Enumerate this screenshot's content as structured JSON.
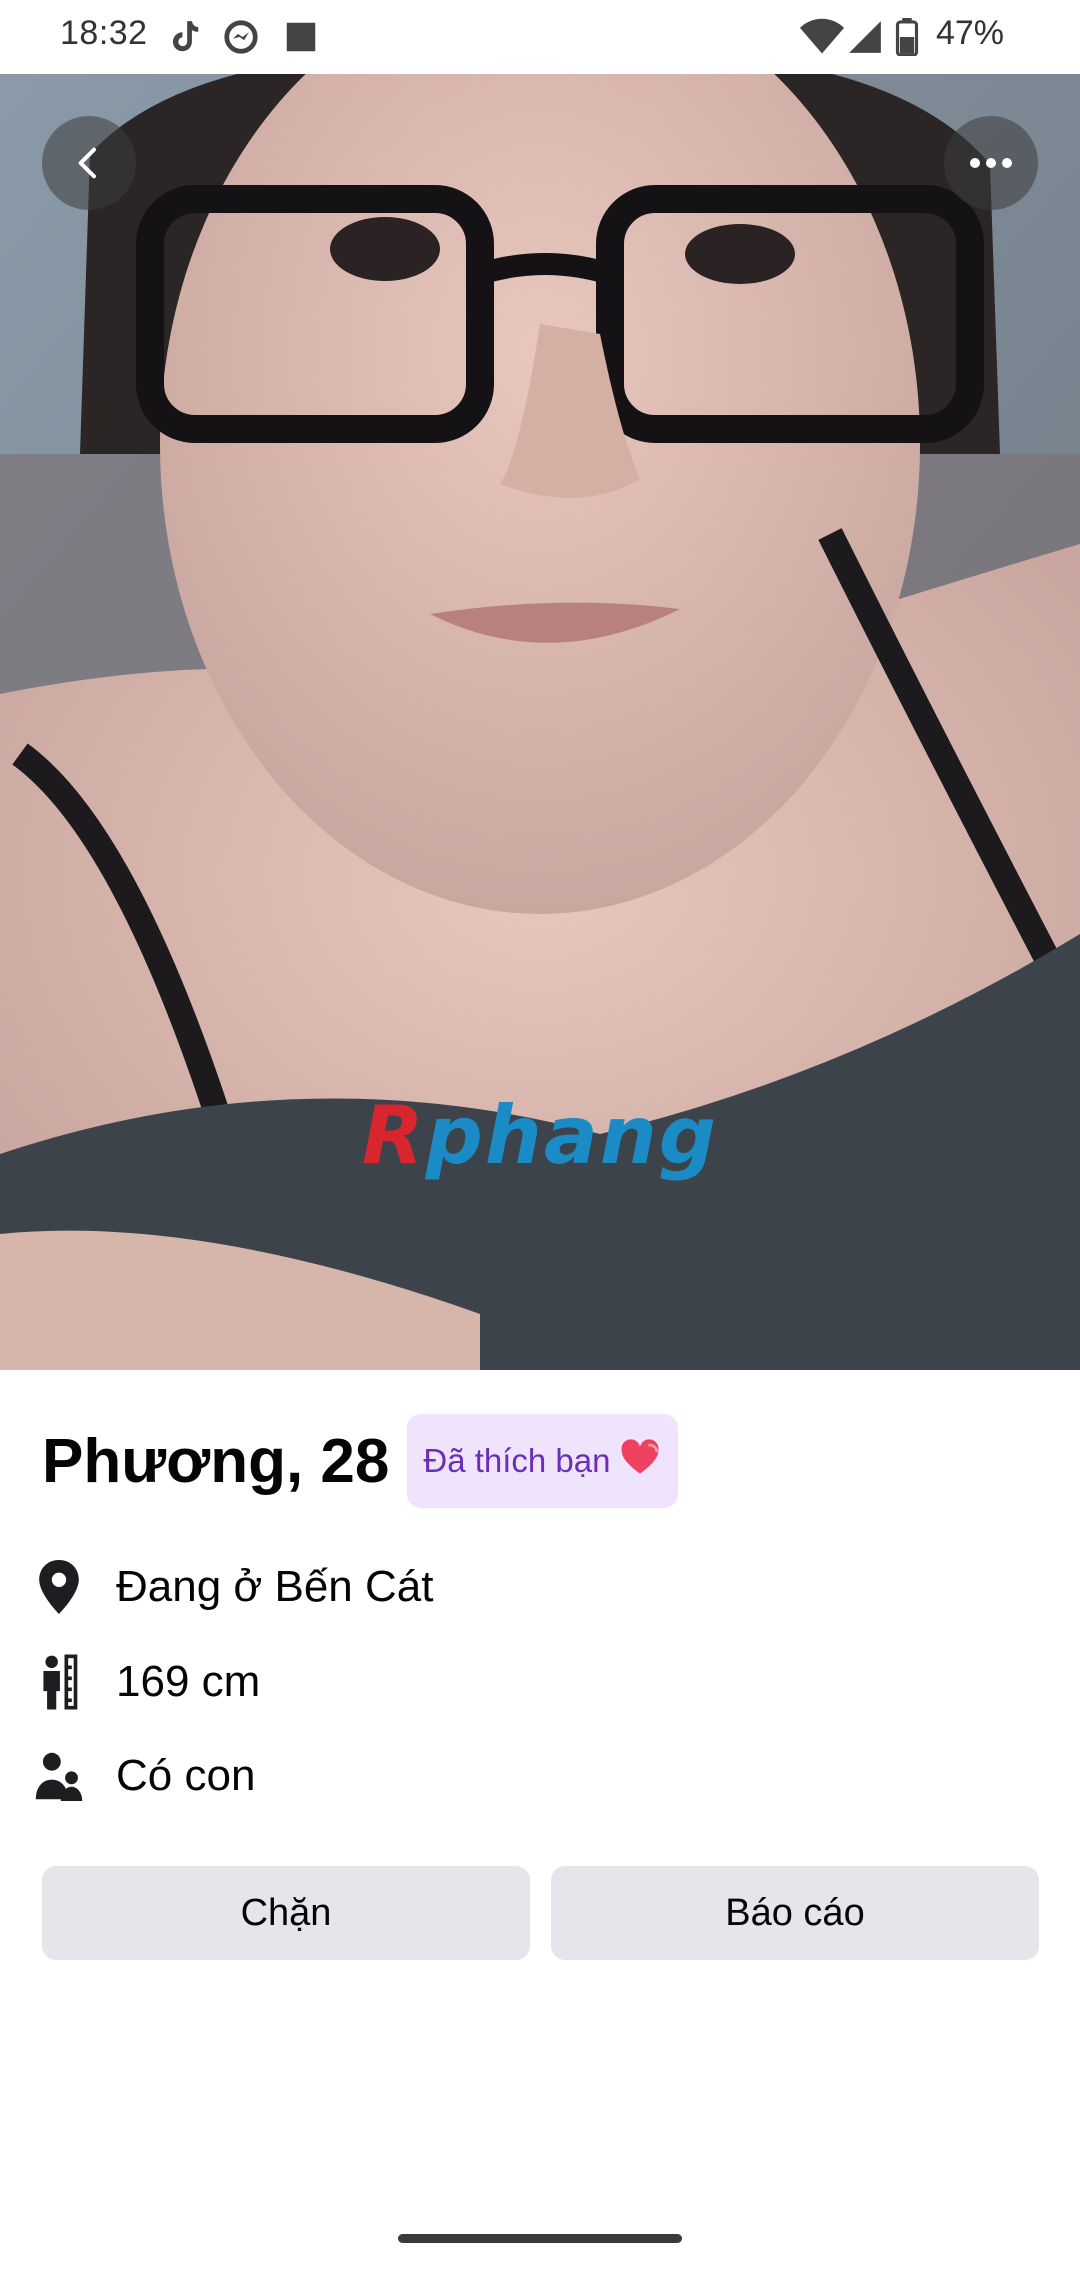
{
  "status_bar": {
    "time": "18:32",
    "battery": "47%",
    "left_icons": [
      "tiktok-icon",
      "messenger-sync-icon",
      "square-icon"
    ],
    "right_icons": [
      "wifi-icon",
      "cell-signal-icon",
      "battery-icon"
    ]
  },
  "photo": {
    "watermark": {
      "first": "R",
      "rest": "phang"
    },
    "back_icon": "chevron-left-icon",
    "more_icon": "more-horizontal-icon"
  },
  "profile": {
    "name_age": "Phương, 28",
    "liked_badge": "Đã thích bạn",
    "liked_badge_emoji": "❤️",
    "details": [
      {
        "icon": "location-pin-icon",
        "text": "Đang ở Bến Cát"
      },
      {
        "icon": "height-icon",
        "text": "169 cm"
      },
      {
        "icon": "children-icon",
        "text": "Có con"
      }
    ]
  },
  "actions": {
    "block_label": "Chặn",
    "report_label": "Báo cáo"
  },
  "colors": {
    "badge_bg": "#efe4fb",
    "badge_text": "#6a2fb8",
    "button_bg": "#e4e6eb",
    "watermark_red": "#d8262f",
    "watermark_blue": "#1a8bc4"
  }
}
